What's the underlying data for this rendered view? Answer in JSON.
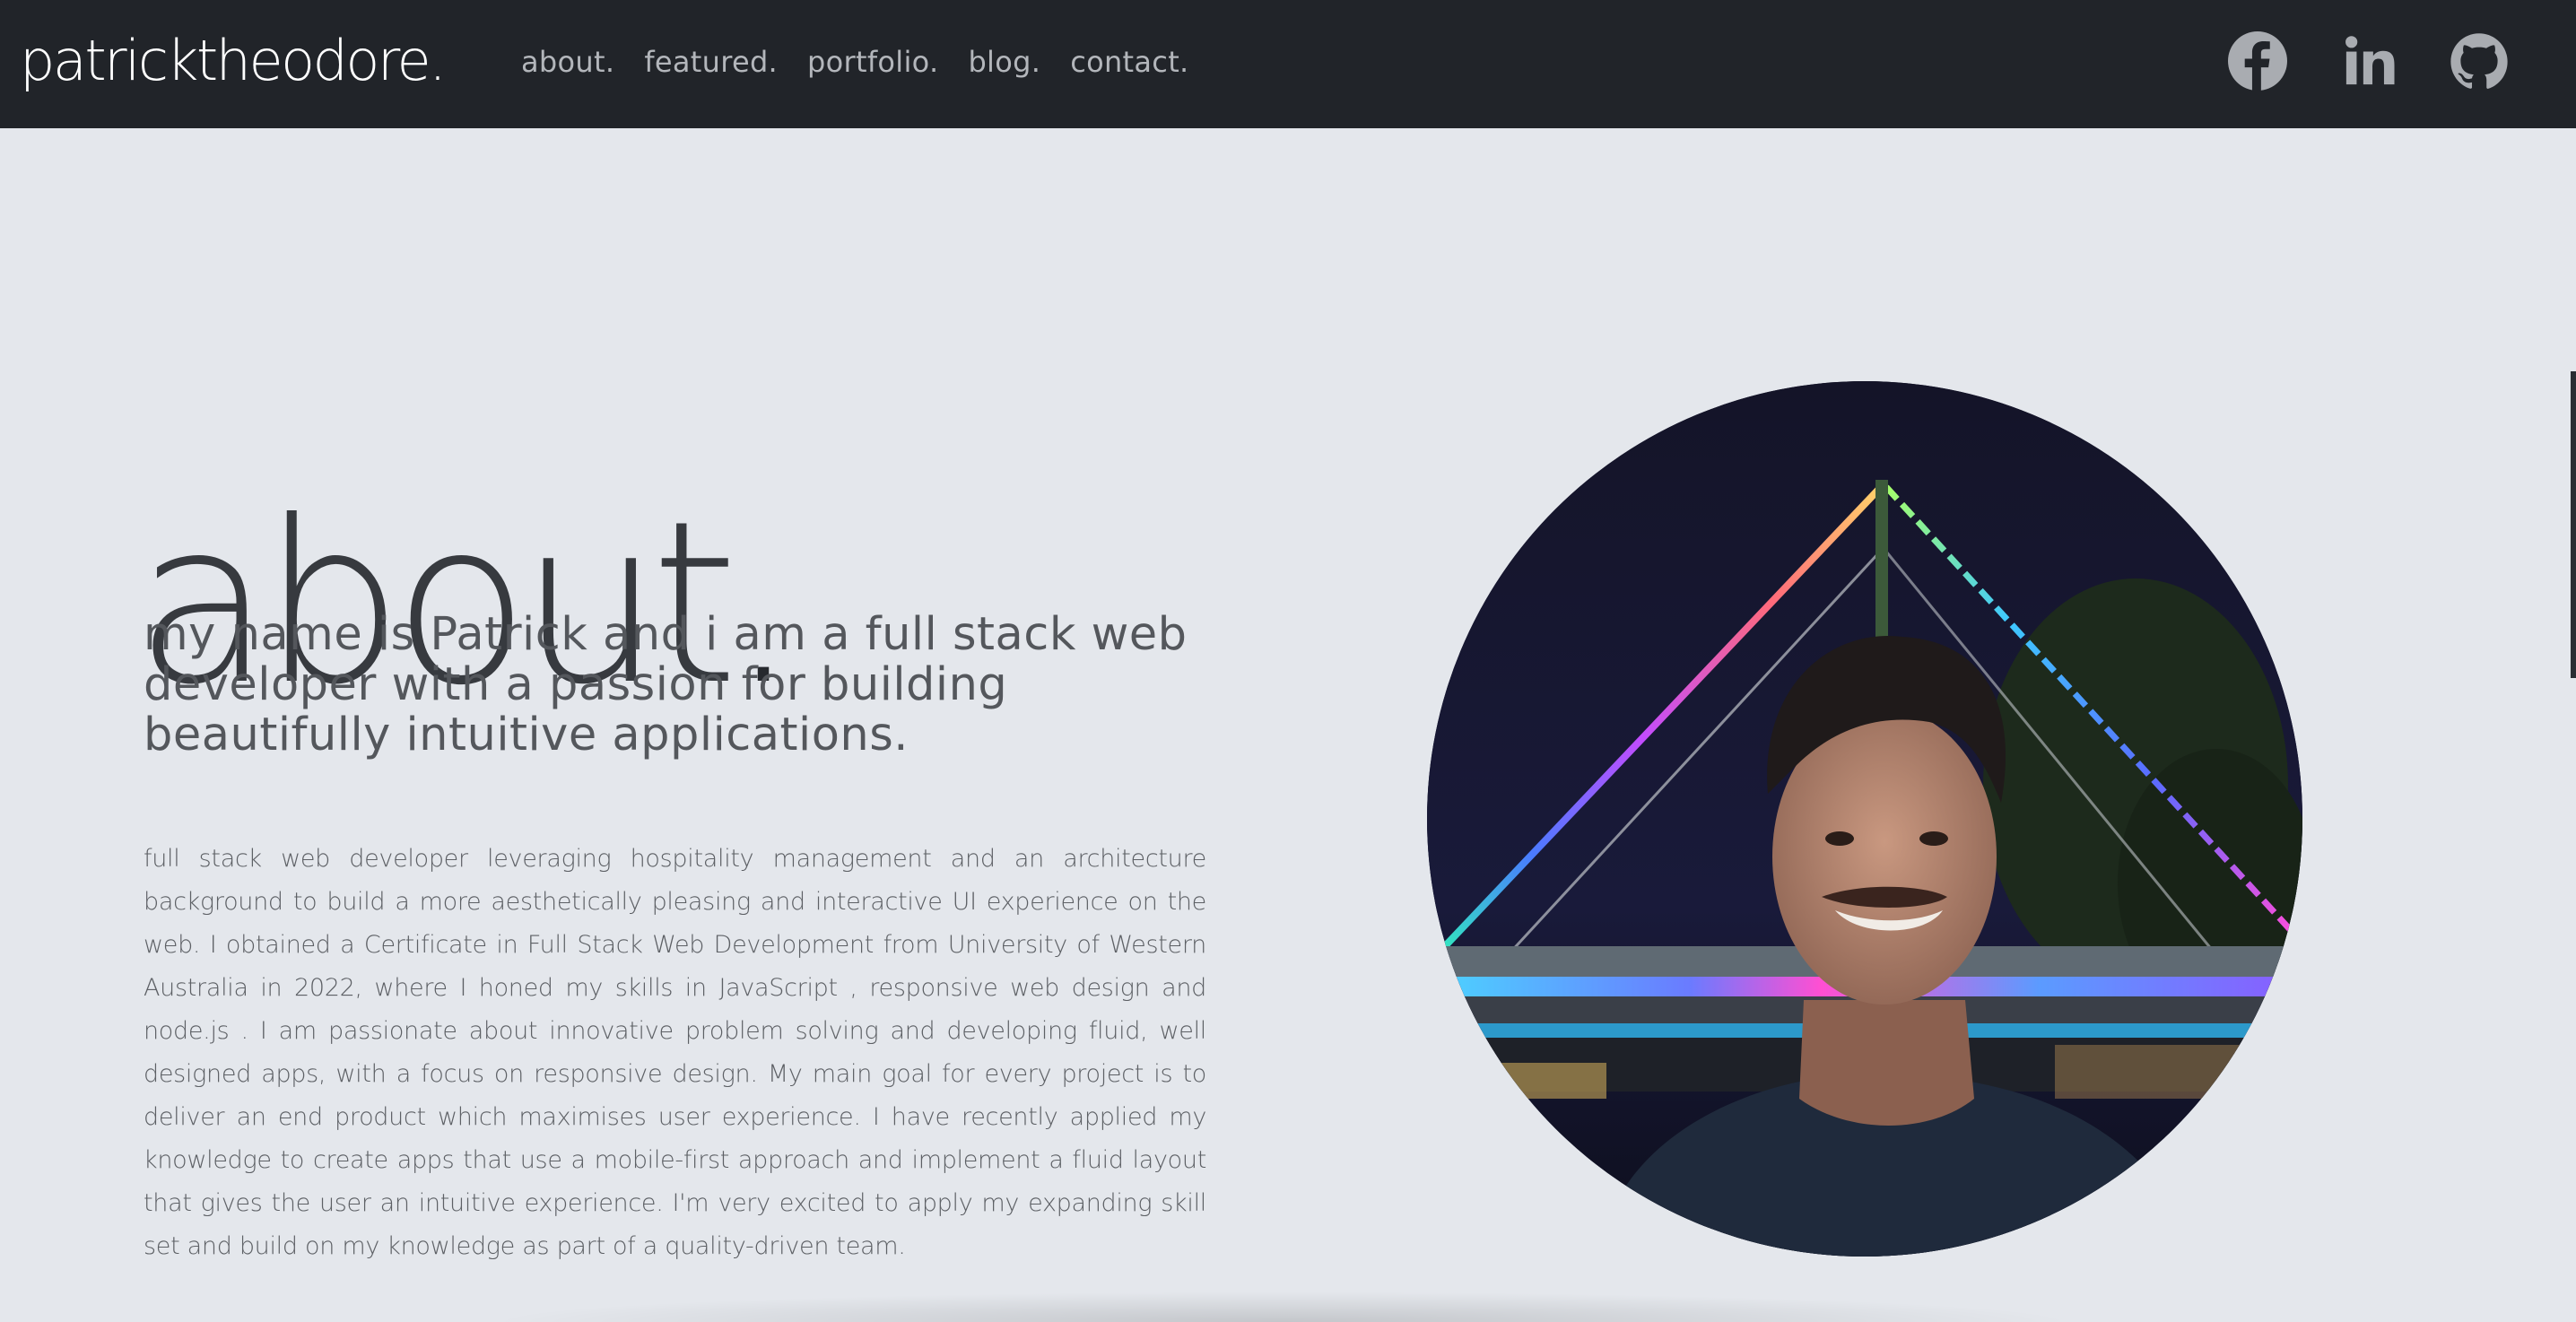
{
  "header": {
    "brand": "patricktheodore.",
    "nav": [
      {
        "label": "about."
      },
      {
        "label": "featured."
      },
      {
        "label": "portfolio."
      },
      {
        "label": "blog."
      },
      {
        "label": "contact."
      }
    ],
    "social_icons": [
      "facebook-icon",
      "linkedin-icon",
      "github-icon"
    ]
  },
  "about": {
    "heading": "about",
    "heading_dot": ".",
    "tagline": "my name is Patrick and i am a full stack web developer with a passion for building beautifully intuitive applications.",
    "bio": "full stack web developer leveraging hospitality management and an architecture background to build a more aesthetically pleasing and interactive UI experience on the web. I obtained a Certificate in Full Stack Web Development from University of Western Australia in 2022, where I honed my skills in JavaScript , responsive web design and node.js . I am passionate about innovative problem solving and developing fluid, well designed apps, with a focus on responsive design. My main goal for every project is to deliver an end product which maximises user experience. I have recently applied my knowledge to create apps that use a mobile-first approach and implement a fluid layout that gives the user an intuitive experience. I'm very excited to apply my expanding skill set and build on my knowledge as part of a quality-driven team."
  },
  "colors": {
    "navbar_bg": "#212429",
    "page_bg": "#e4e7ec",
    "heading": "#373a3f",
    "body_text": "#5d6065",
    "nav_text": "#b3b6bb"
  }
}
